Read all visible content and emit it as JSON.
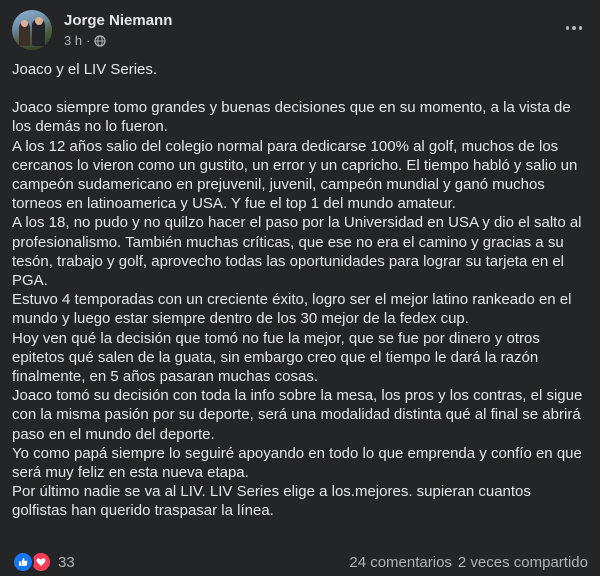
{
  "post": {
    "author": "Jorge Niemann",
    "time": "3 h",
    "separator": "·",
    "reaction_count": "33",
    "comments": "24 comentarios",
    "shares": "2 veces compartido",
    "paragraphs": [
      "Joaco y el LIV Series.",
      "",
      "Joaco siempre tomo grandes y buenas decisiones que en su momento, a la vista de los demás no lo fueron.",
      "A los 12 años salio del colegio normal para dedicarse 100% al golf, muchos de los cercanos lo vieron como un gustito, un error y un capricho. El tiempo habló y salio un campeón sudamericano en prejuvenil, juvenil, campeón mundial y ganó muchos torneos en latinoamerica y USA. Y fue el top 1 del mundo amateur.",
      "A los 18, no pudo y no quilzo hacer el paso por la Universidad en USA y dio el salto al profesionalismo. También muchas críticas, que ese no era el camino y gracias a su tesón, trabajo y golf, aprovecho todas las oportunidades para lograr su tarjeta en el PGA.",
      "Estuvo 4 temporadas con un creciente éxito, logro ser el mejor latino rankeado en el mundo y luego estar siempre dentro de los 30 mejor de la fedex cup.",
      "Hoy ven qué la decisión que tomó no fue la mejor, que se fue por dinero y otros epitetos qué salen de la guata, sin embargo creo que el tiempo le dará la razón finalmente, en 5 años pasaran muchas cosas.",
      "Joaco tomó su decisión con toda la info sobre la mesa, los pros y los contras, el sigue con la misma pasión por su deporte, será una modalidad distinta qué al final se abrirá paso en el mundo del deporte.",
      "Yo como papá siempre lo seguiré apoyando en todo lo que emprenda y confío en que será muy feliz en esta nueva etapa.",
      "Por último nadie se va al LIV. LIV Series elige a los.mejores. supieran cuantos golfistas han querido traspasar la línea."
    ]
  },
  "icons": {
    "globe": "globe-icon",
    "more": "more-options-icon",
    "like": "like-reaction-icon",
    "love": "love-reaction-icon"
  },
  "colors": {
    "background": "#242526",
    "text": "#e4e6eb",
    "secondary": "#b0b3b8",
    "like": "#1877f2",
    "love": "#f33e58"
  }
}
